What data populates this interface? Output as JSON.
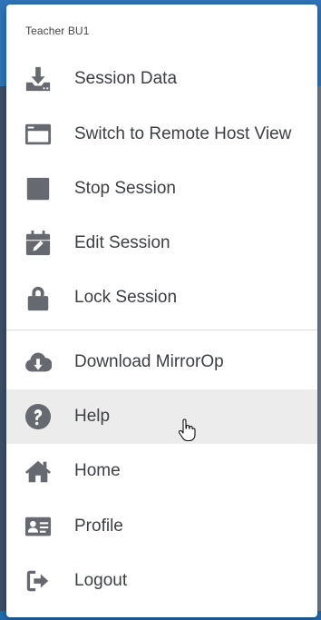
{
  "user": {
    "name": "Teacher BU1"
  },
  "menu": {
    "items": [
      {
        "label": "Session Data",
        "icon": "download-tray-icon"
      },
      {
        "label": "Switch to Remote Host View",
        "icon": "browser-window-icon"
      },
      {
        "label": "Stop Session",
        "icon": "stop-square-icon"
      },
      {
        "label": "Edit Session",
        "icon": "calendar-edit-icon"
      },
      {
        "label": "Lock Session",
        "icon": "lock-icon"
      },
      {
        "label": "Download MirrorOp",
        "icon": "cloud-download-icon"
      },
      {
        "label": "Help",
        "icon": "question-circle-icon",
        "hovered": true
      },
      {
        "label": "Home",
        "icon": "home-icon"
      },
      {
        "label": "Profile",
        "icon": "id-card-icon"
      },
      {
        "label": "Logout",
        "icon": "sign-out-icon"
      }
    ]
  },
  "colors": {
    "icon": "#666a70",
    "text": "#3c3f44",
    "hover_bg": "#ececec"
  }
}
